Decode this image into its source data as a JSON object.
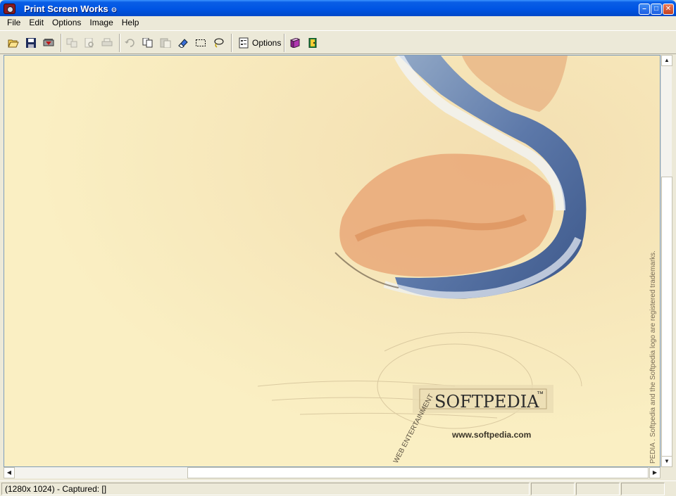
{
  "window": {
    "title": "Print Screen Works",
    "title_badge": "⊝",
    "minimize_label": "–",
    "maximize_label": "□",
    "close_label": "✕"
  },
  "menu": {
    "items": [
      {
        "label": "File"
      },
      {
        "label": "Edit"
      },
      {
        "label": "Options"
      },
      {
        "label": "Image"
      },
      {
        "label": "Help"
      }
    ]
  },
  "toolbar": {
    "options_label": "Options",
    "icons": [
      "open-folder-icon",
      "save-icon",
      "capture-icon",
      "copy-to-icon",
      "print-preview-icon",
      "print-icon",
      "undo-icon",
      "copy-icon",
      "paste-icon",
      "eraser-icon",
      "rect-select-icon",
      "lasso-icon",
      "options-icon",
      "book-icon",
      "exit-door-icon"
    ]
  },
  "canvas": {
    "logo_text": "SOFTPEDIA",
    "logo_tm": "™",
    "url_text": "www.softpedia.com",
    "side_text": "PEDIA . Softpedia and the Softpedia logo are registered trademarks.",
    "arc_text": "WEB  ENTERTAINMENT"
  },
  "statusbar": {
    "info": "(1280x 1024) - Captured: []"
  },
  "colors": {
    "title_blue": "#0054e3",
    "chrome": "#ece9d8",
    "canvas_bg": "#f8ebbd"
  }
}
